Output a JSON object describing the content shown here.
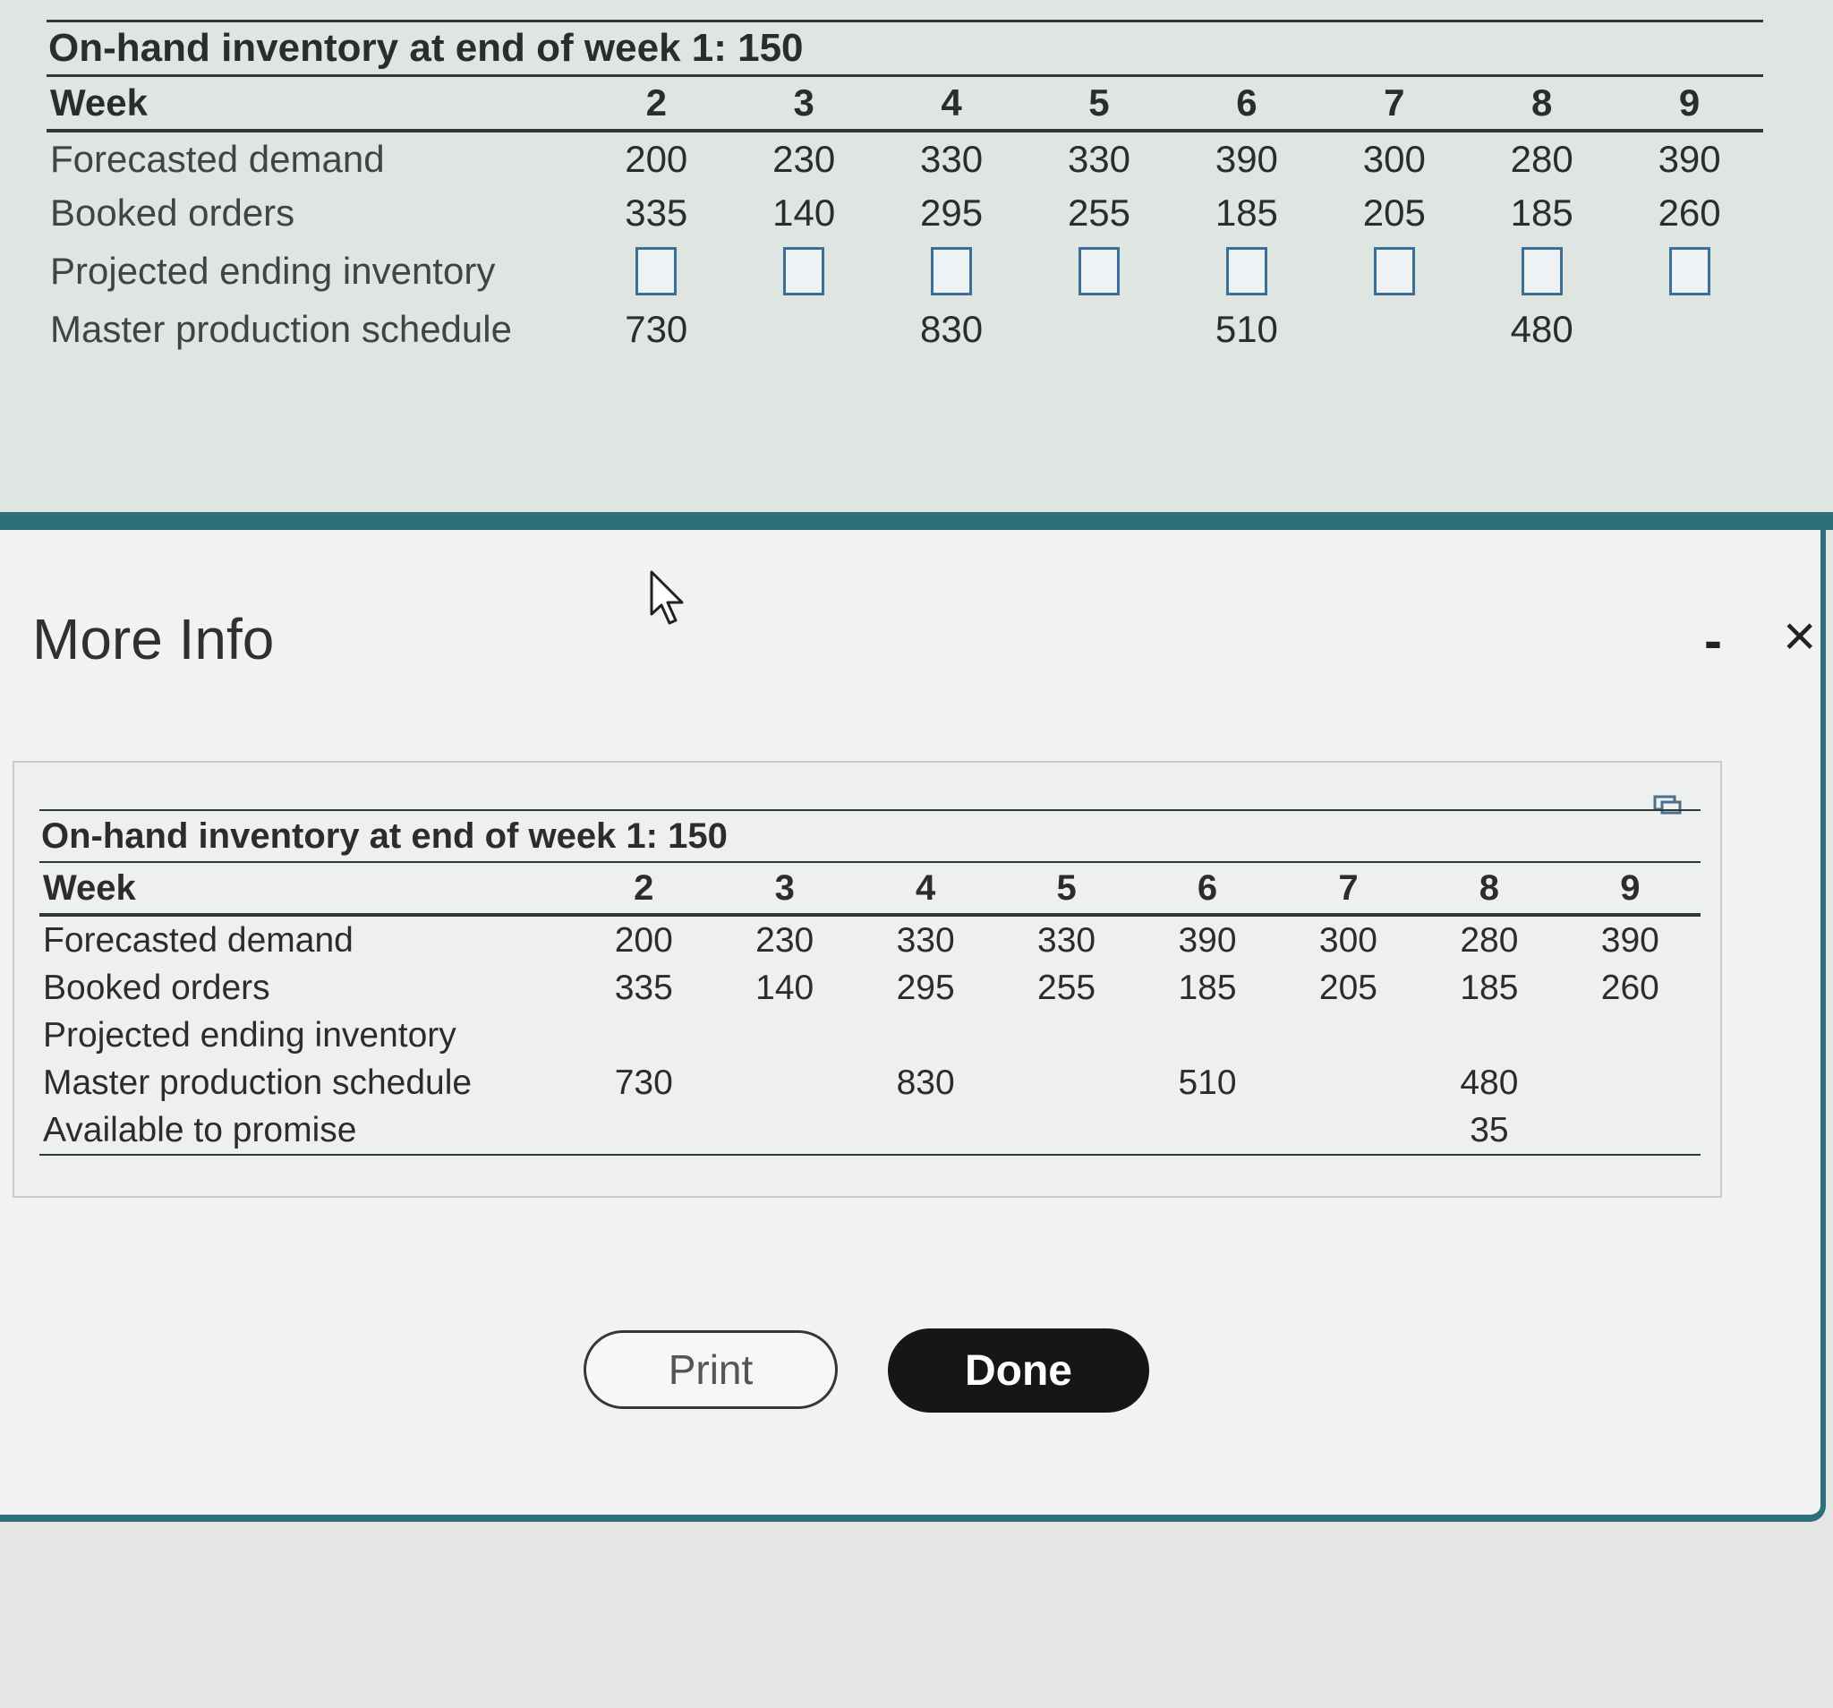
{
  "table": {
    "title": "On-hand inventory at end of week 1: 150",
    "week_label": "Week",
    "weeks": [
      "2",
      "3",
      "4",
      "5",
      "6",
      "7",
      "8",
      "9"
    ],
    "rows": {
      "forecast": {
        "label": "Forecasted demand",
        "values": [
          "200",
          "230",
          "330",
          "330",
          "390",
          "300",
          "280",
          "390"
        ]
      },
      "booked": {
        "label": "Booked orders",
        "values": [
          "335",
          "140",
          "295",
          "255",
          "185",
          "205",
          "185",
          "260"
        ]
      },
      "projected": {
        "label": "Projected ending inventory",
        "values": [
          "",
          "",
          "",
          "",
          "",
          "",
          "",
          ""
        ]
      },
      "mps": {
        "label": "Master production schedule",
        "values": [
          "730",
          "",
          "830",
          "",
          "510",
          "",
          "480",
          ""
        ]
      },
      "atp": {
        "label": "Available to promise",
        "values": [
          "",
          "",
          "",
          "",
          "",
          "",
          "35",
          ""
        ]
      }
    }
  },
  "dialog": {
    "title": "More Info",
    "minimize": "-",
    "close": "×",
    "print_label": "Print",
    "done_label": "Done"
  },
  "colors": {
    "accent": "#2f6f7c",
    "input_border": "#3c6f95",
    "done_bg": "#141617"
  }
}
